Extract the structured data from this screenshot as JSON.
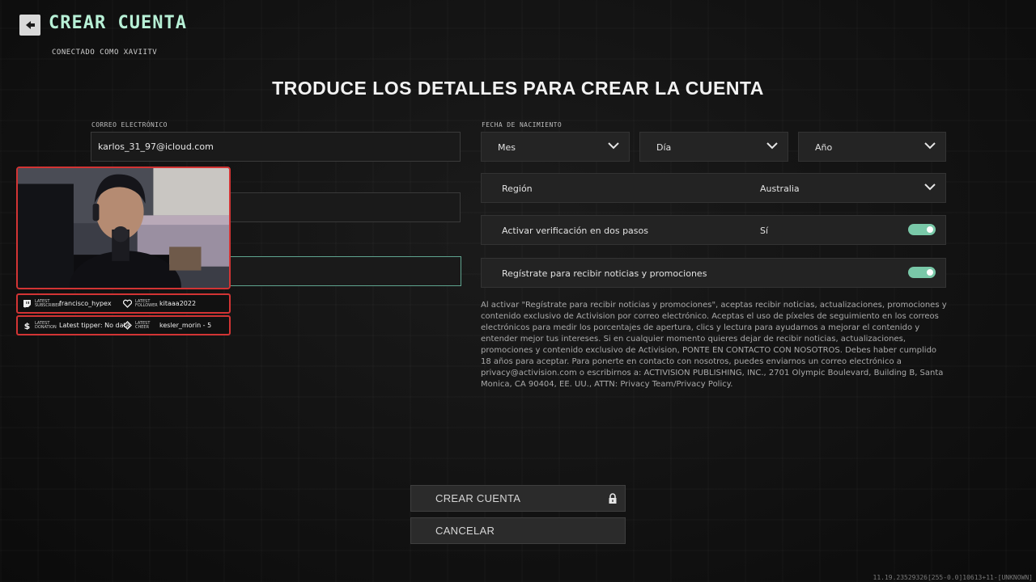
{
  "header": {
    "title": "CREAR CUENTA",
    "connected": "CONECTADO COMO XAVIITV"
  },
  "main": {
    "heading": "TRODUCE LOS DETALLES PARA CREAR LA CUENTA"
  },
  "form": {
    "email_label": "CORREO ELECTRÓNICO",
    "email_value": "karlos_31_97@icloud.com",
    "dob_label": "FECHA DE NACIMIENTO",
    "month": "Mes",
    "day": "Día",
    "year": "Año",
    "region_label": "Región",
    "region_value": "Australia",
    "twofa_label": "Activar verificación en dos pasos",
    "twofa_value": "Sí",
    "newsletter_label": "Regístrate para recibir noticias y promociones"
  },
  "legal": {
    "text": "Al activar \"Regístrate para recibir noticias y promociones\", aceptas recibir noticias, actualizaciones, promociones y contenido exclusivo de Activision por correo electrónico. Aceptas el uso de píxeles de seguimiento en los correos electrónicos para medir los porcentajes de apertura, clics y lectura para ayudarnos a mejorar el contenido y entender mejor tus intereses. Si en cualquier momento quieres dejar de recibir noticias, actualizaciones, promociones y contenido exclusivo de Activision, PONTE EN CONTACTO CON NOSOTROS. Debes haber cumplido 18 años para aceptar. Para ponerte en contacto con nosotros, puedes enviarnos un correo electrónico a privacy@activision.com o escribirnos a: ACTIVISION PUBLISHING, INC., 2701 Olympic Boulevard, Building B, Santa Monica, CA 90404, EE. UU., ATTN: Privacy Team/Privacy Policy."
  },
  "buttons": {
    "create": "CREAR CUENTA",
    "cancel": "CANCELAR"
  },
  "overlay": {
    "subscriber_label": "LATEST SUBSCRIBER",
    "subscriber_value": "francisco_hypex",
    "follower_label": "LATEST FOLLOWER",
    "follower_value": "kitaaa2022",
    "donation_label": "LATEST DONATION",
    "donation_value": "Latest tipper: No data",
    "cheer_label": "LATEST CHEER",
    "cheer_value": "kesler_morin - 5"
  },
  "build_string": "11.19.23529326[255-0.0]10613+11-[UNKNOWN]",
  "colors": {
    "accent": "#b7f0d6",
    "toggle_on": "#79c8a8",
    "overlay_red": "#d23434"
  }
}
